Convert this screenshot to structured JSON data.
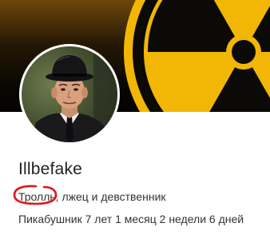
{
  "profile": {
    "username": "Illbefake",
    "bio_highlight": "Тролль,",
    "bio_rest": " лжец и девственник",
    "tenure": "Пикабушник 7 лет 1 месяц 2 недели 6 дней"
  },
  "icons": {
    "cover": "radiation-symbol-icon",
    "avatar": "user-photo-man-in-bowler-hat"
  },
  "colors": {
    "accent_yellow": "#f2b705",
    "cover_dark": "#0a0703",
    "highlight_circle": "#e0151a",
    "text": "#333333"
  }
}
